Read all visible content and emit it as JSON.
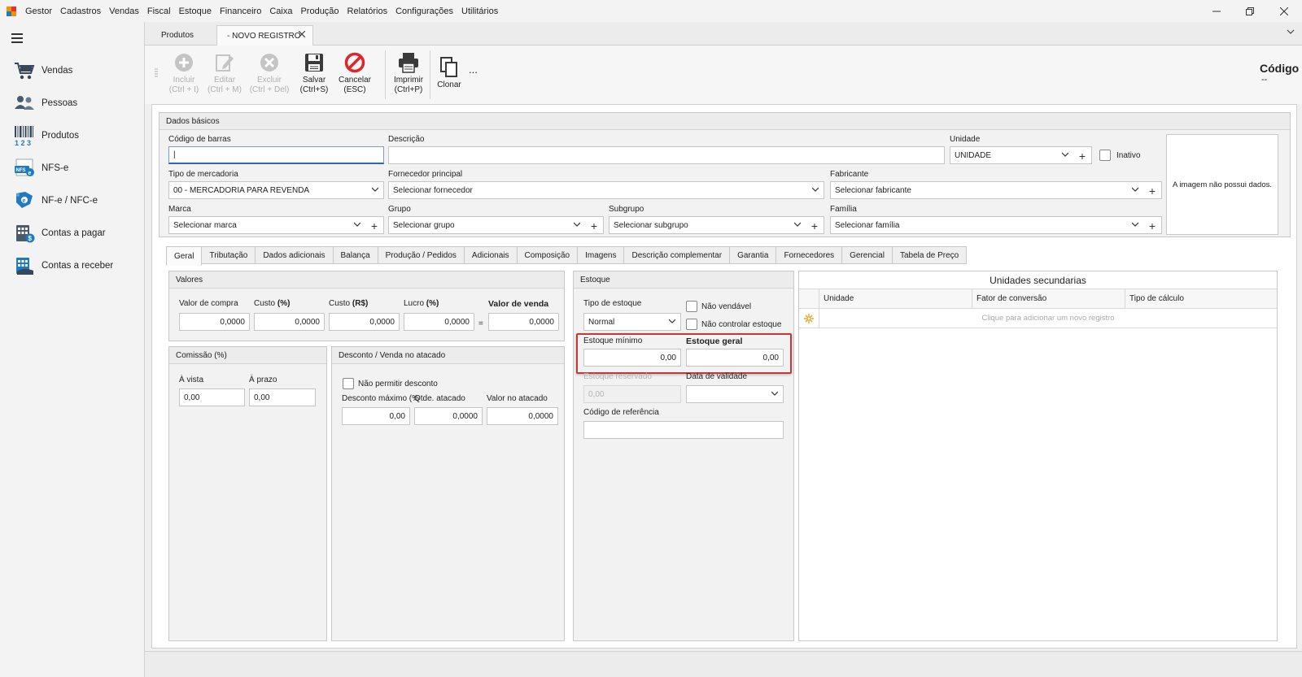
{
  "menu": {
    "items": [
      "Gestor",
      "Cadastros",
      "Vendas",
      "Fiscal",
      "Estoque",
      "Financeiro",
      "Caixa",
      "Produção",
      "Relatórios",
      "Configurações",
      "Utilitários"
    ]
  },
  "sidebar": {
    "items": [
      {
        "label": "Vendas",
        "icon": "cart-icon"
      },
      {
        "label": "Pessoas",
        "icon": "people-icon"
      },
      {
        "label": "Produtos",
        "icon": "barcode-icon"
      },
      {
        "label": "NFS-e",
        "icon": "nfse-icon"
      },
      {
        "label": "NF-e / NFC-e",
        "icon": "nfe-icon"
      },
      {
        "label": "Contas a pagar",
        "icon": "payable-icon"
      },
      {
        "label": "Contas a receber",
        "icon": "receivable-icon"
      }
    ]
  },
  "tabs": [
    {
      "label": "Produtos"
    },
    {
      "label": "- NOVO REGISTRO"
    }
  ],
  "toolbar": {
    "incluir": "Incluir",
    "incluir_key": "(Ctrl + I)",
    "editar": "Editar",
    "editar_key": "(Ctrl + M)",
    "excluir": "Excluir",
    "excluir_key": "(Ctrl + Del)",
    "salvar": "Salvar",
    "salvar_key": "(Ctrl+S)",
    "cancelar": "Cancelar",
    "cancelar_key": "(ESC)",
    "imprimir": "Imprimir",
    "imprimir_key": "(Ctrl+P)",
    "clonar": "Clonar",
    "more": "...",
    "codigo_label": "Código",
    "codigo_value": "--"
  },
  "dados_basicos": {
    "title": "Dados básicos",
    "codigo_barras_label": "Código de barras",
    "codigo_barras_value": "|",
    "descricao_label": "Descrição",
    "unidade_label": "Unidade",
    "unidade_value": "UNIDADE",
    "inativo_label": "Inativo",
    "tipo_mercadoria_label": "Tipo de mercadoria",
    "tipo_mercadoria_value": "00 - MERCADORIA PARA REVENDA",
    "fornecedor_label": "Fornecedor principal",
    "fornecedor_value": "Selecionar fornecedor",
    "fabricante_label": "Fabricante",
    "fabricante_value": "Selecionar fabricante",
    "marca_label": "Marca",
    "marca_value": "Selecionar marca",
    "grupo_label": "Grupo",
    "grupo_value": "Selecionar grupo",
    "subgrupo_label": "Subgrupo",
    "subgrupo_value": "Selecionar subgrupo",
    "familia_label": "Família",
    "familia_value": "Selecionar família",
    "imagem_text": "A imagem não possui dados."
  },
  "subtabs": [
    "Geral",
    "Tributação",
    "Dados adicionais",
    "Balança",
    "Produção / Pedidos",
    "Adicionais",
    "Composição",
    "Imagens",
    "Descrição complementar",
    "Garantia",
    "Fornecedores",
    "Gerencial",
    "Tabela de Preço"
  ],
  "valores": {
    "title": "Valores",
    "valor_compra_label": "Valor de compra",
    "valor_compra": "0,0000",
    "custo_pct_label": "Custo ",
    "custo_pct_suffix": "(%)",
    "custo_pct": "0,0000",
    "custo_rs_label": "Custo ",
    "custo_rs_suffix": "(R$)",
    "custo_rs": "0,0000",
    "lucro_label": "Lucro ",
    "lucro_suffix": "(%)",
    "lucro": "0,0000",
    "eq": "=",
    "valor_venda_label": "Valor de venda",
    "valor_venda": "0,0000"
  },
  "comissao": {
    "title": "Comissão (%)",
    "avista_label": "À vista",
    "avista": "0,00",
    "aprazo_label": "À prazo",
    "aprazo": "0,00"
  },
  "desconto": {
    "title": "Desconto / Venda no atacado",
    "nao_permitir_label": "Não permitir desconto",
    "desconto_max_label": "Desconto máximo (%",
    "desconto_max": "0,00",
    "qtde_label": "Qtde. atacado",
    "qtde": "0,0000",
    "valor_label": "Valor no atacado",
    "valor": "0,0000"
  },
  "estoque": {
    "title": "Estoque",
    "tipo_label": "Tipo de estoque",
    "tipo_value": "Normal",
    "nao_vendavel_label": "Não vendável",
    "nao_controlar_label": "Não controlar estoque",
    "minimo_label": "Estoque mínimo",
    "minimo": "0,00",
    "geral_label": "Estoque geral",
    "geral": "0,00",
    "reservado_label": "Estoque reservado",
    "reservado": "0,00",
    "validade_label": "Data de validade",
    "referencia_label": "Código de referência",
    "highlight_color": "#c0393b"
  },
  "unidades_secundarias": {
    "title": "Unidades secundarias",
    "columns": [
      "Unidade",
      "Fator de conversão",
      "Tipo de cálculo"
    ],
    "new_row_text": "Clique para adicionar um novo registro"
  },
  "colors": {
    "accent_blue": "#2a66b8",
    "cancel_red": "#e0252d",
    "disabled_gray": "#b0b0b0"
  }
}
